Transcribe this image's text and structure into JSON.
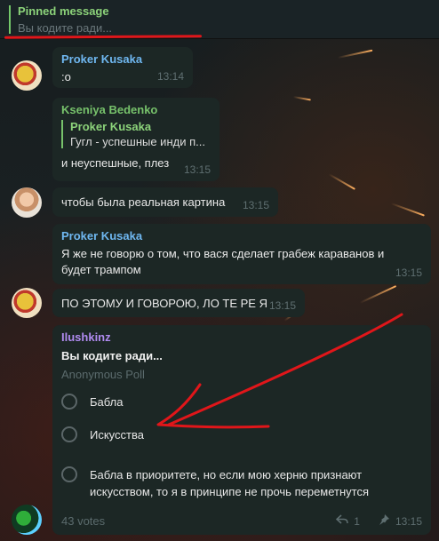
{
  "pinned": {
    "title": "Pinned message",
    "text": "Вы кодите ради..."
  },
  "messages": [
    {
      "sender": "Proker Kusaka",
      "text": ":o",
      "time": "13:14"
    },
    {
      "sender": "Kseniya Bedenko",
      "reply_sender": "Proker Kusaka",
      "reply_text": "Гугл - успешные инди п...",
      "text": "и неуспешные, плез",
      "time": "13:15"
    },
    {
      "text": "чтобы была реальная картина",
      "time": "13:15"
    },
    {
      "sender": "Proker Kusaka",
      "text": "Я же не говорю о том, что вася сделает грабеж караванов и будет трампом",
      "time": "13:15"
    },
    {
      "text": "ПО ЭТОМУ И ГОВОРОЮ, ЛО ТЕ РЕ Я",
      "time": "13:15"
    }
  ],
  "poll": {
    "sender": "Ilushkinz",
    "question": "Вы кодите ради...",
    "type": "Anonymous Poll",
    "options": [
      "Бабла",
      "Искусства",
      "Бабла в приоритете, но если мою херню признают искусством, то я в принципе не прочь переметнутся"
    ],
    "votes": "43 votes",
    "replies": "1",
    "time": "13:15"
  },
  "icons": {
    "reply": "reply-arrow-icon",
    "pin": "pin-icon"
  },
  "colors": {
    "pinned_accent": "#74c86a",
    "annotation_red": "#e0161a"
  }
}
